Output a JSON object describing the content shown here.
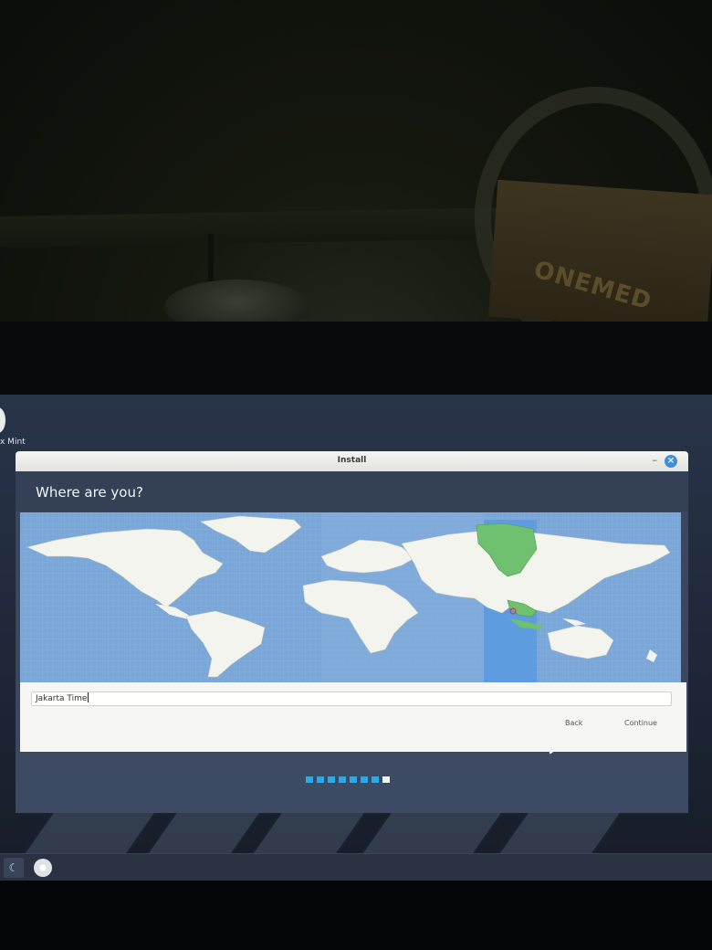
{
  "background_box_text": "ONEMED",
  "desktop": {
    "icon_label": "x Mint"
  },
  "window": {
    "title": "Install",
    "minimize_glyph": "–",
    "close_glyph": "×"
  },
  "page": {
    "title": "Where are you?"
  },
  "map": {
    "selected_timezone_color": "#6fc06f",
    "ocean_color": "#7aa7d8",
    "land_color": "#f3f4ee",
    "highlight_band_color": "#5b9be0"
  },
  "timezone_field": {
    "value": "Jakarta Time"
  },
  "buttons": {
    "back": "Back",
    "continue": "Continue"
  },
  "progress": {
    "total_steps": 8,
    "current_step": 8
  },
  "taskbar": {
    "menu_icon": "mint-menu-icon",
    "cd_icon": "cd-icon"
  }
}
